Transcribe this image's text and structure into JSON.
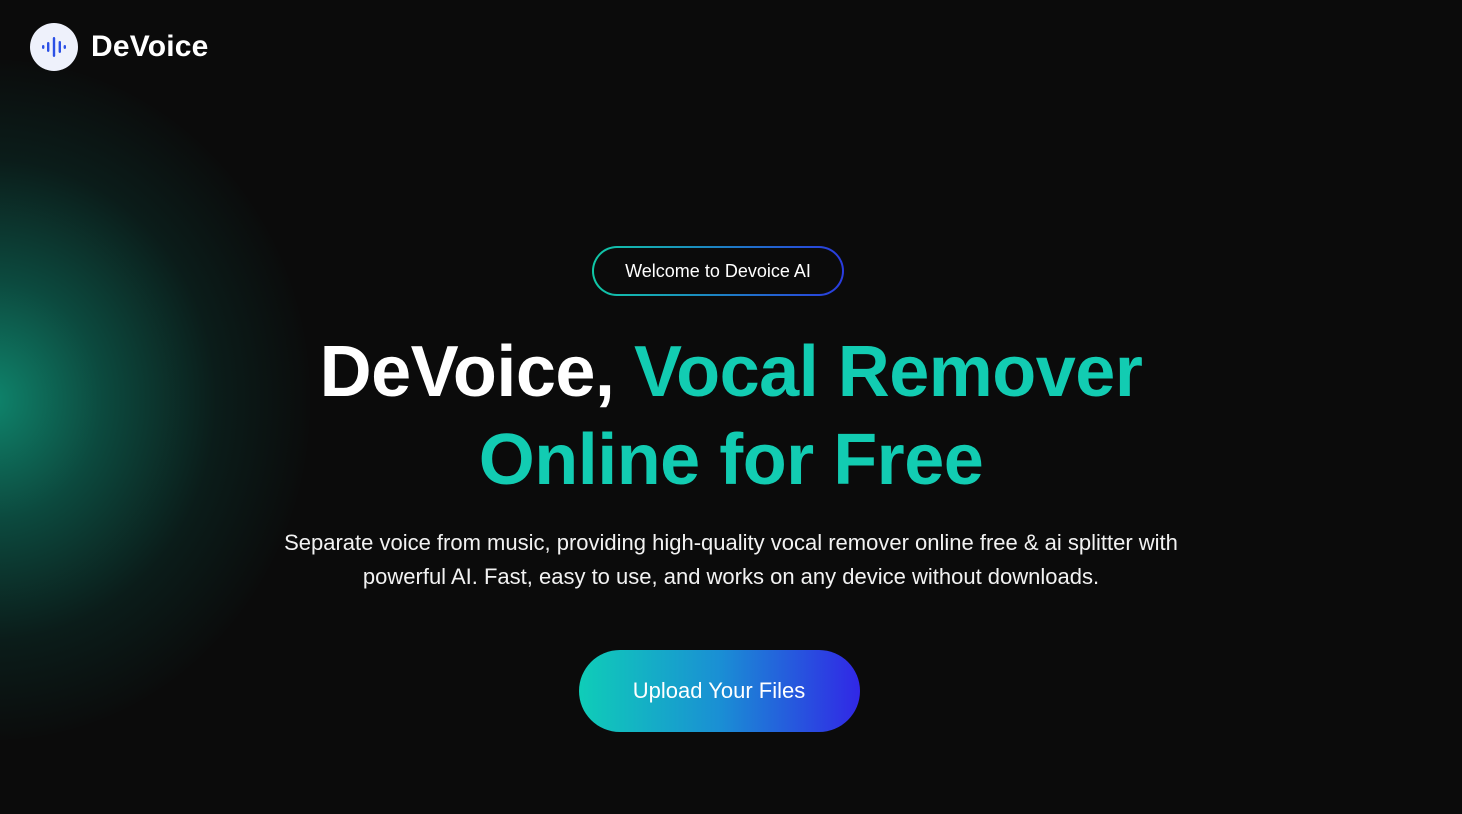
{
  "header": {
    "brand": "DeVoice",
    "logo_icon": "sound-wave-icon"
  },
  "hero": {
    "pill_text": "Welcome to Devoice AI",
    "title_part1": "DeVoice,",
    "title_part2": "Vocal Remover",
    "title_part3": "Online for Free",
    "subtitle_line1": "Separate voice from music, providing high-quality vocal remover online free & ai splitter with",
    "subtitle_line2": "powerful AI. Fast, easy to use, and works on any device without downloads.",
    "cta_label": "Upload Your Files"
  },
  "colors": {
    "background": "#0b0b0b",
    "accent": "#12ccb2",
    "gradient_start": "#0fcdb8",
    "gradient_end": "#3127e6",
    "logo_wave": "#2b50e6"
  }
}
